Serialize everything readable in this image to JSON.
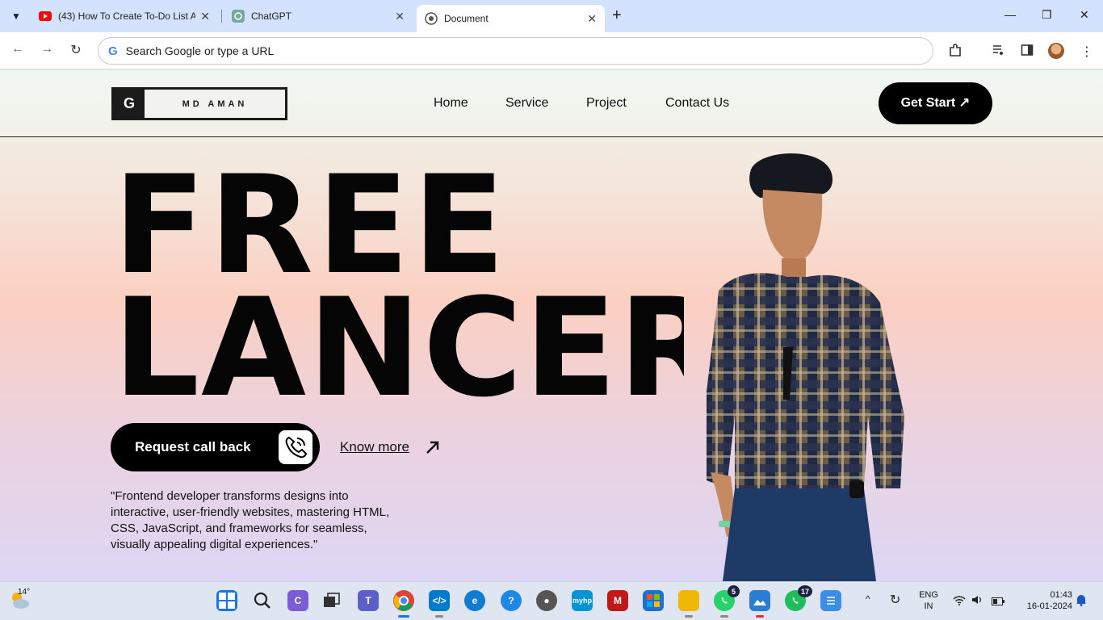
{
  "browser": {
    "tabs": [
      {
        "title": "(43) How To Create To-Do List A",
        "icon": "youtube-icon"
      },
      {
        "title": "ChatGPT",
        "icon": "chatgpt-icon"
      },
      {
        "title": "Document",
        "icon": "globe-icon",
        "active": true
      }
    ],
    "new_tab_label": "+",
    "omnibox_placeholder": "Search Google or type a URL",
    "window_controls": [
      "minimize",
      "restore",
      "close"
    ]
  },
  "site": {
    "logo_mark": "G",
    "logo_text": "MD AMAN",
    "nav": [
      "Home",
      "Service",
      "Project",
      "Contact Us"
    ],
    "get_start": "Get Start",
    "get_start_arrow": "↗",
    "hero_line1": "FREE",
    "hero_line2": "LANCER",
    "cta_label": "Request call back",
    "know_more": "Know more",
    "quote": "\"Frontend developer transforms designs into interactive, user-friendly websites, mastering HTML, CSS, JavaScript, and frameworks for seamless, visually appealing digital experiences.\""
  },
  "taskbar": {
    "weather": "14°",
    "apps": [
      {
        "name": "start-icon",
        "color": "#1a73e8"
      },
      {
        "name": "search-icon",
        "color": "#333333"
      },
      {
        "name": "copilot-icon",
        "color": "#7b5cd6"
      },
      {
        "name": "task-view-icon",
        "color": "#333333"
      },
      {
        "name": "teams-icon",
        "color": "#5b5fc7"
      },
      {
        "name": "chrome-icon",
        "color": "#db4437"
      },
      {
        "name": "vscode-icon",
        "color": "#007acc"
      },
      {
        "name": "edge-icon",
        "color": "#0f7bd1"
      },
      {
        "name": "help-icon",
        "color": "#1e88e5"
      },
      {
        "name": "media-icon",
        "color": "#555555"
      },
      {
        "name": "myhp-icon",
        "color": "#0096d6"
      },
      {
        "name": "mcafee-icon",
        "color": "#c01818"
      },
      {
        "name": "store-icon",
        "color": "#1f6fd1"
      },
      {
        "name": "file-explorer-icon",
        "color": "#f2b705"
      },
      {
        "name": "whatsapp-icon",
        "color": "#25d366"
      },
      {
        "name": "photos-icon",
        "color": "#2b7cd3"
      },
      {
        "name": "whatsapp-business-icon",
        "color": "#1ebe5d"
      },
      {
        "name": "notepad-icon",
        "color": "#3a8ee6"
      }
    ],
    "whatsapp_badge": "5",
    "whatsapp_business_badge": "17",
    "language_top": "ENG",
    "language_bottom": "IN",
    "time": "01:43",
    "date": "16-01-2024"
  }
}
